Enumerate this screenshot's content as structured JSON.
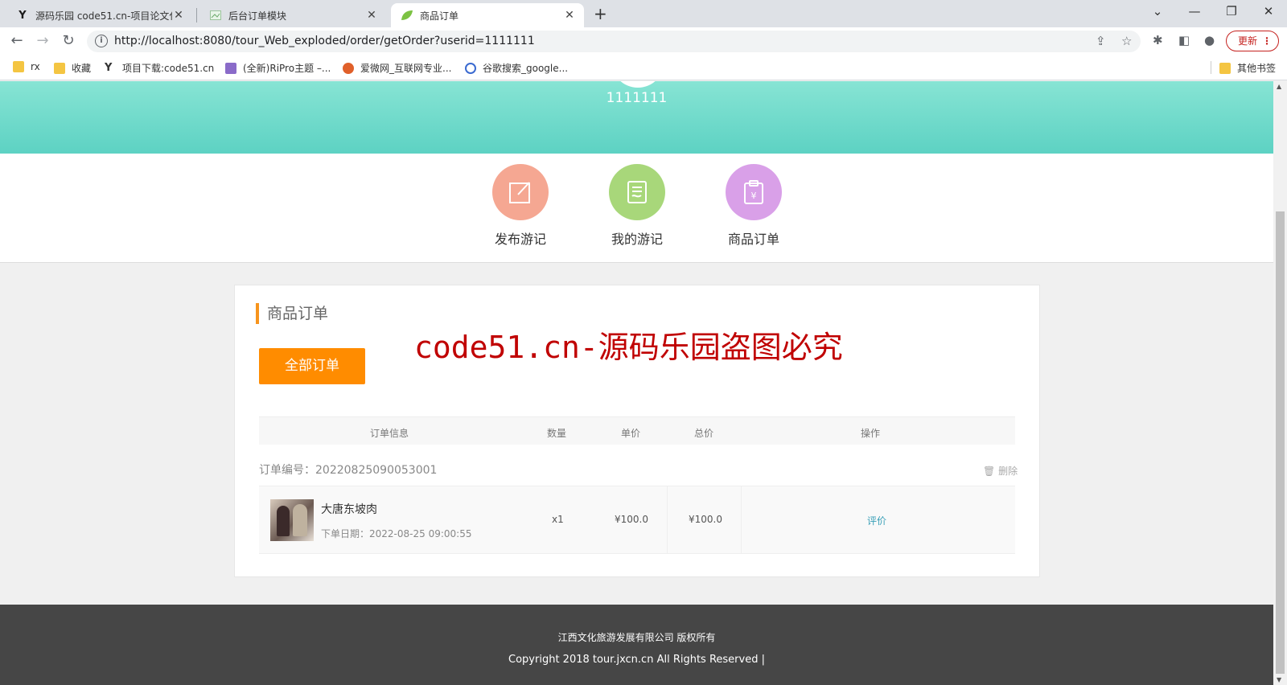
{
  "browser": {
    "tabs": [
      {
        "title": "源码乐园 code51.cn-项目论文代",
        "icon": "y-logo-icon"
      },
      {
        "title": "后台订单模块",
        "icon": "page-icon"
      },
      {
        "title": "商品订单",
        "icon": "leaf-icon"
      }
    ],
    "new_tab": "+",
    "url": "http://localhost:8080/tour_Web_exploded/order/getOrder?userid=1111111",
    "update_label": "更新",
    "bookmarks": [
      {
        "label": "rx",
        "icon": "folder-icon"
      },
      {
        "label": "收藏",
        "icon": "folder-icon"
      },
      {
        "label": "项目下载:code51.cn",
        "icon": "y-logo-icon"
      },
      {
        "label": "(全新)RiPro主题 –...",
        "icon": "ripro-icon"
      },
      {
        "label": "爱微网_互联网专业...",
        "icon": "aiwei-icon"
      },
      {
        "label": "谷歌搜索_google...",
        "icon": "search-360-icon"
      }
    ],
    "other_bookmarks": "其他书签"
  },
  "profile": {
    "user_id": "1111111"
  },
  "menu": [
    {
      "label": "发布游记",
      "icon": "edit-icon",
      "color": "#f5a792"
    },
    {
      "label": "我的游记",
      "icon": "notes-icon",
      "color": "#a8d77a"
    },
    {
      "label": "商品订单",
      "icon": "clipboard-yen-icon",
      "color": "#d9a0e8"
    }
  ],
  "orders": {
    "title": "商品订单",
    "all_orders_button": "全部订单",
    "watermark": "code51.cn-源码乐园盗图必究",
    "columns": [
      "订单信息",
      "数量",
      "单价",
      "总价",
      "操作"
    ],
    "order_no_label": "订单编号：",
    "order_no": "20220825090053001",
    "delete_label": "删除",
    "items": [
      {
        "name": "大唐东坡肉",
        "date_label": "下单日期：",
        "date": "2022-08-25 09:00:55",
        "quantity": "x1",
        "unit_price": "¥100.0",
        "total_price": "¥100.0",
        "action": "评价"
      }
    ]
  },
  "footer": {
    "company": "江西文化旅游发展有限公司 版权所有",
    "copyright": "Copyright 2018 tour.jxcn.cn All Rights Reserved |"
  },
  "colors": {
    "hero": "#6ad9c8",
    "accent_orange": "#ff8c00",
    "title_bar": "#f7941d",
    "watermark": "#c00000",
    "footer": "#464646",
    "link": "#3aa0b8"
  }
}
